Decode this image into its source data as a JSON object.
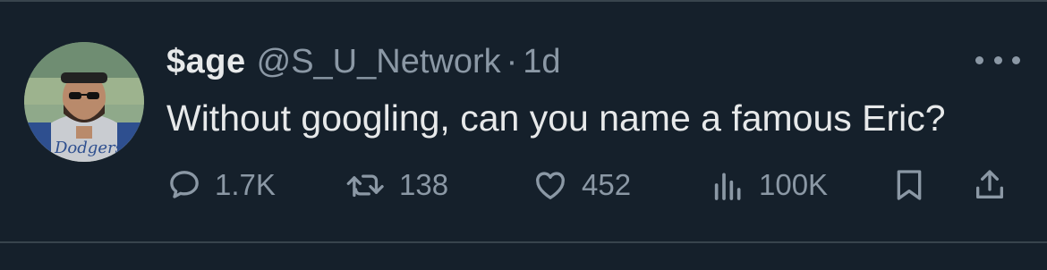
{
  "tweet": {
    "author": {
      "display_name": "$age",
      "handle": "@S_U_Network"
    },
    "separator": "·",
    "time": "1d",
    "text": "Without googling, can you name a famous Eric?",
    "stats": {
      "replies": "1.7K",
      "retweets": "138",
      "likes": "452",
      "views": "100K"
    },
    "icons": {
      "reply": "speech-bubble-icon",
      "retweet": "retweet-arrows-icon",
      "like": "heart-icon",
      "views": "bar-chart-icon",
      "bookmark": "bookmark-icon",
      "share": "share-upload-icon",
      "more": "more-horizontal-icon"
    },
    "colors": {
      "background": "#15202b",
      "primary_text": "#e7e9ea",
      "secondary_text": "#8b98a5",
      "divider": "#38444d"
    }
  }
}
